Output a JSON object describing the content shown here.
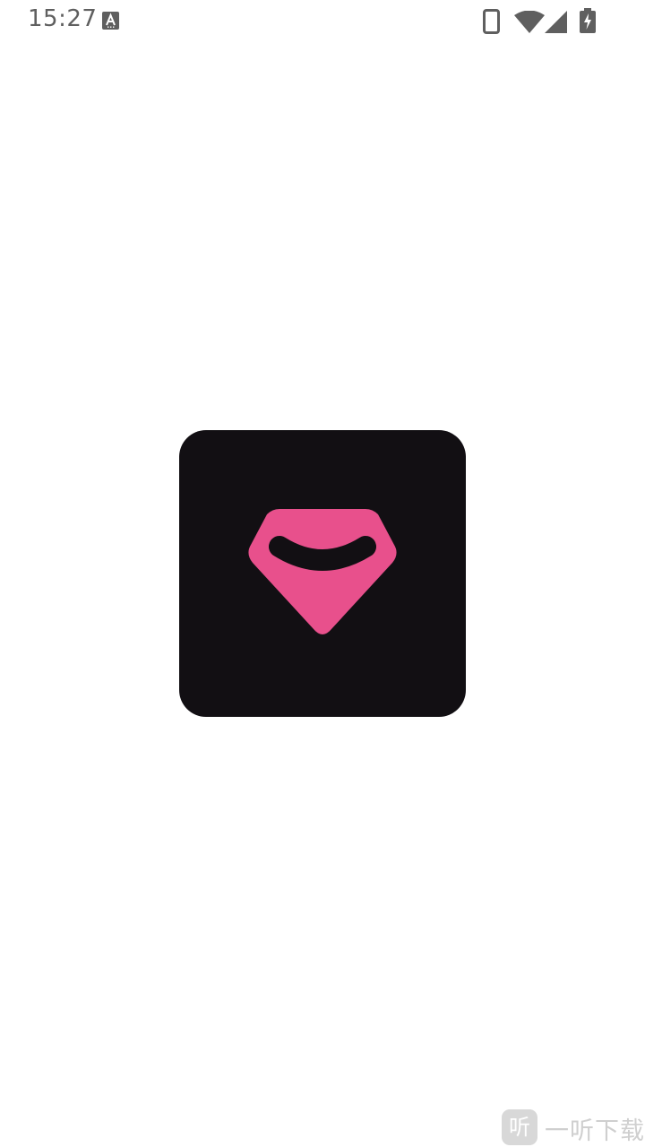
{
  "status_bar": {
    "time": "15:27",
    "icons": [
      "accessibility-notification-icon",
      "phone-icon",
      "wifi-icon",
      "cell-signal-icon",
      "battery-charging-icon"
    ]
  },
  "splash": {
    "logo": "diamond-smile-logo",
    "colors": {
      "logo_background": "#120f13",
      "logo_mark": "#e8508c",
      "page_background": "#ffffff"
    }
  },
  "watermark": {
    "badge_char": "听",
    "text": "一听下载"
  }
}
